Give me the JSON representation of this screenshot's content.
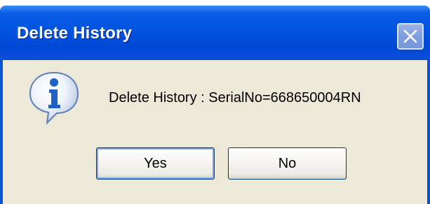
{
  "window": {
    "title": "Delete History",
    "close_icon": "close-icon"
  },
  "dialog": {
    "icon": "info-icon",
    "message": "Delete History : SerialNo=668650004RN"
  },
  "buttons": {
    "yes_label": "Yes",
    "no_label": "No"
  },
  "colors": {
    "title_bar": "#0055e0",
    "client_bg": "#ece9d8",
    "icon_blue": "#1f5fc8"
  }
}
